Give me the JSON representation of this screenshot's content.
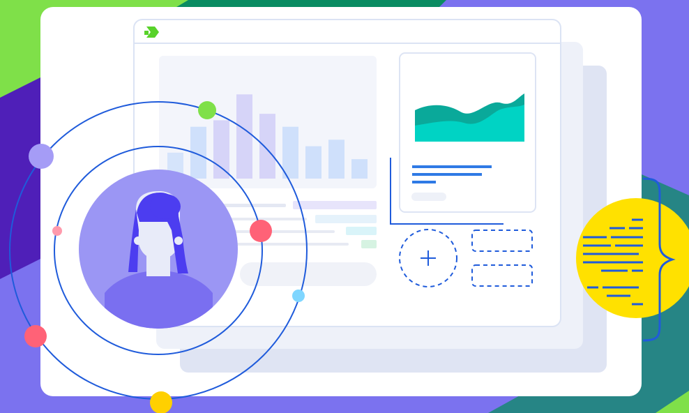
{
  "palette": {
    "background_purple": "#7b72ef",
    "deep_purple": "#4f1fb8",
    "lime_green": "#7fe049",
    "teal_green": "#0a8c62",
    "panel_white": "#ffffff",
    "accent_blue": "#1f5bdb",
    "avatar_purple": "#9b96f4",
    "avatar_dark": "#4c3df0",
    "area_teal": "#00d3c4",
    "area_teal_dark": "#0aa99a",
    "code_yellow": "#ffe100",
    "dot_red": "#ff6277",
    "dot_yellow": "#ffd000",
    "dot_cyan": "#7fd6ff",
    "dot_lavender": "#a59cf6",
    "dot_pink": "#ff9aac"
  },
  "icons": {
    "logo": "arrow-logo-icon",
    "add": "plus-icon",
    "braces": "curly-brace-icon",
    "person": "user-avatar-icon"
  },
  "chart_data": {
    "type": "bar",
    "categories": [],
    "series": [
      {
        "values": [
          4,
          8,
          9,
          13,
          10,
          8,
          5,
          6,
          3
        ]
      }
    ],
    "ylim": [
      0,
      14
    ],
    "title": "",
    "xlabel": "",
    "ylabel": ""
  }
}
